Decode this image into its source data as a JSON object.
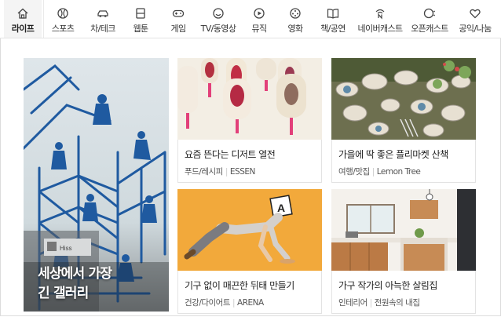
{
  "nav": {
    "items": [
      {
        "label": "라이프",
        "icon": "house-icon"
      },
      {
        "label": "스포츠",
        "icon": "ball-icon"
      },
      {
        "label": "차/테크",
        "icon": "car-icon"
      },
      {
        "label": "웹툰",
        "icon": "book-icon"
      },
      {
        "label": "게임",
        "icon": "gamepad-icon"
      },
      {
        "label": "TV/동영상",
        "icon": "smiley-icon"
      },
      {
        "label": "뮤직",
        "icon": "play-icon"
      },
      {
        "label": "영화",
        "icon": "film-reel-icon"
      },
      {
        "label": "책/공연",
        "icon": "open-book-icon"
      },
      {
        "label": "네이버캐스트",
        "icon": "cast-icon"
      },
      {
        "label": "오픈캐스트",
        "icon": "opencast-icon"
      },
      {
        "label": "공익/나눔",
        "icon": "heart-icon"
      }
    ],
    "active_index": 0
  },
  "hero": {
    "title_line1": "세상에서 가장",
    "title_line2": "긴 갤러리",
    "sign_text": "Hiss"
  },
  "cards": [
    {
      "title": "요즘 뜬다는 디저트 열전",
      "category": "푸드/레시피",
      "source": "ESSEN"
    },
    {
      "title": "가을에 딱 좋은 플리마켓 산책",
      "category": "여행/맛집",
      "source": "Lemon Tree"
    },
    {
      "title": "기구 없이 매끈한 뒤태 만들기",
      "category": "건강/다이어트",
      "source": "ARENA"
    },
    {
      "title": "가구 작가의 아늑한 살림집",
      "category": "인테리어",
      "source": "전원속의 내집"
    }
  ],
  "colors": {
    "active_tab_bg": "#f4f4f4",
    "dessert_bg": "#f5efe3",
    "fitness_bg": "#f2a93b",
    "market_bg": "#6f7452"
  }
}
